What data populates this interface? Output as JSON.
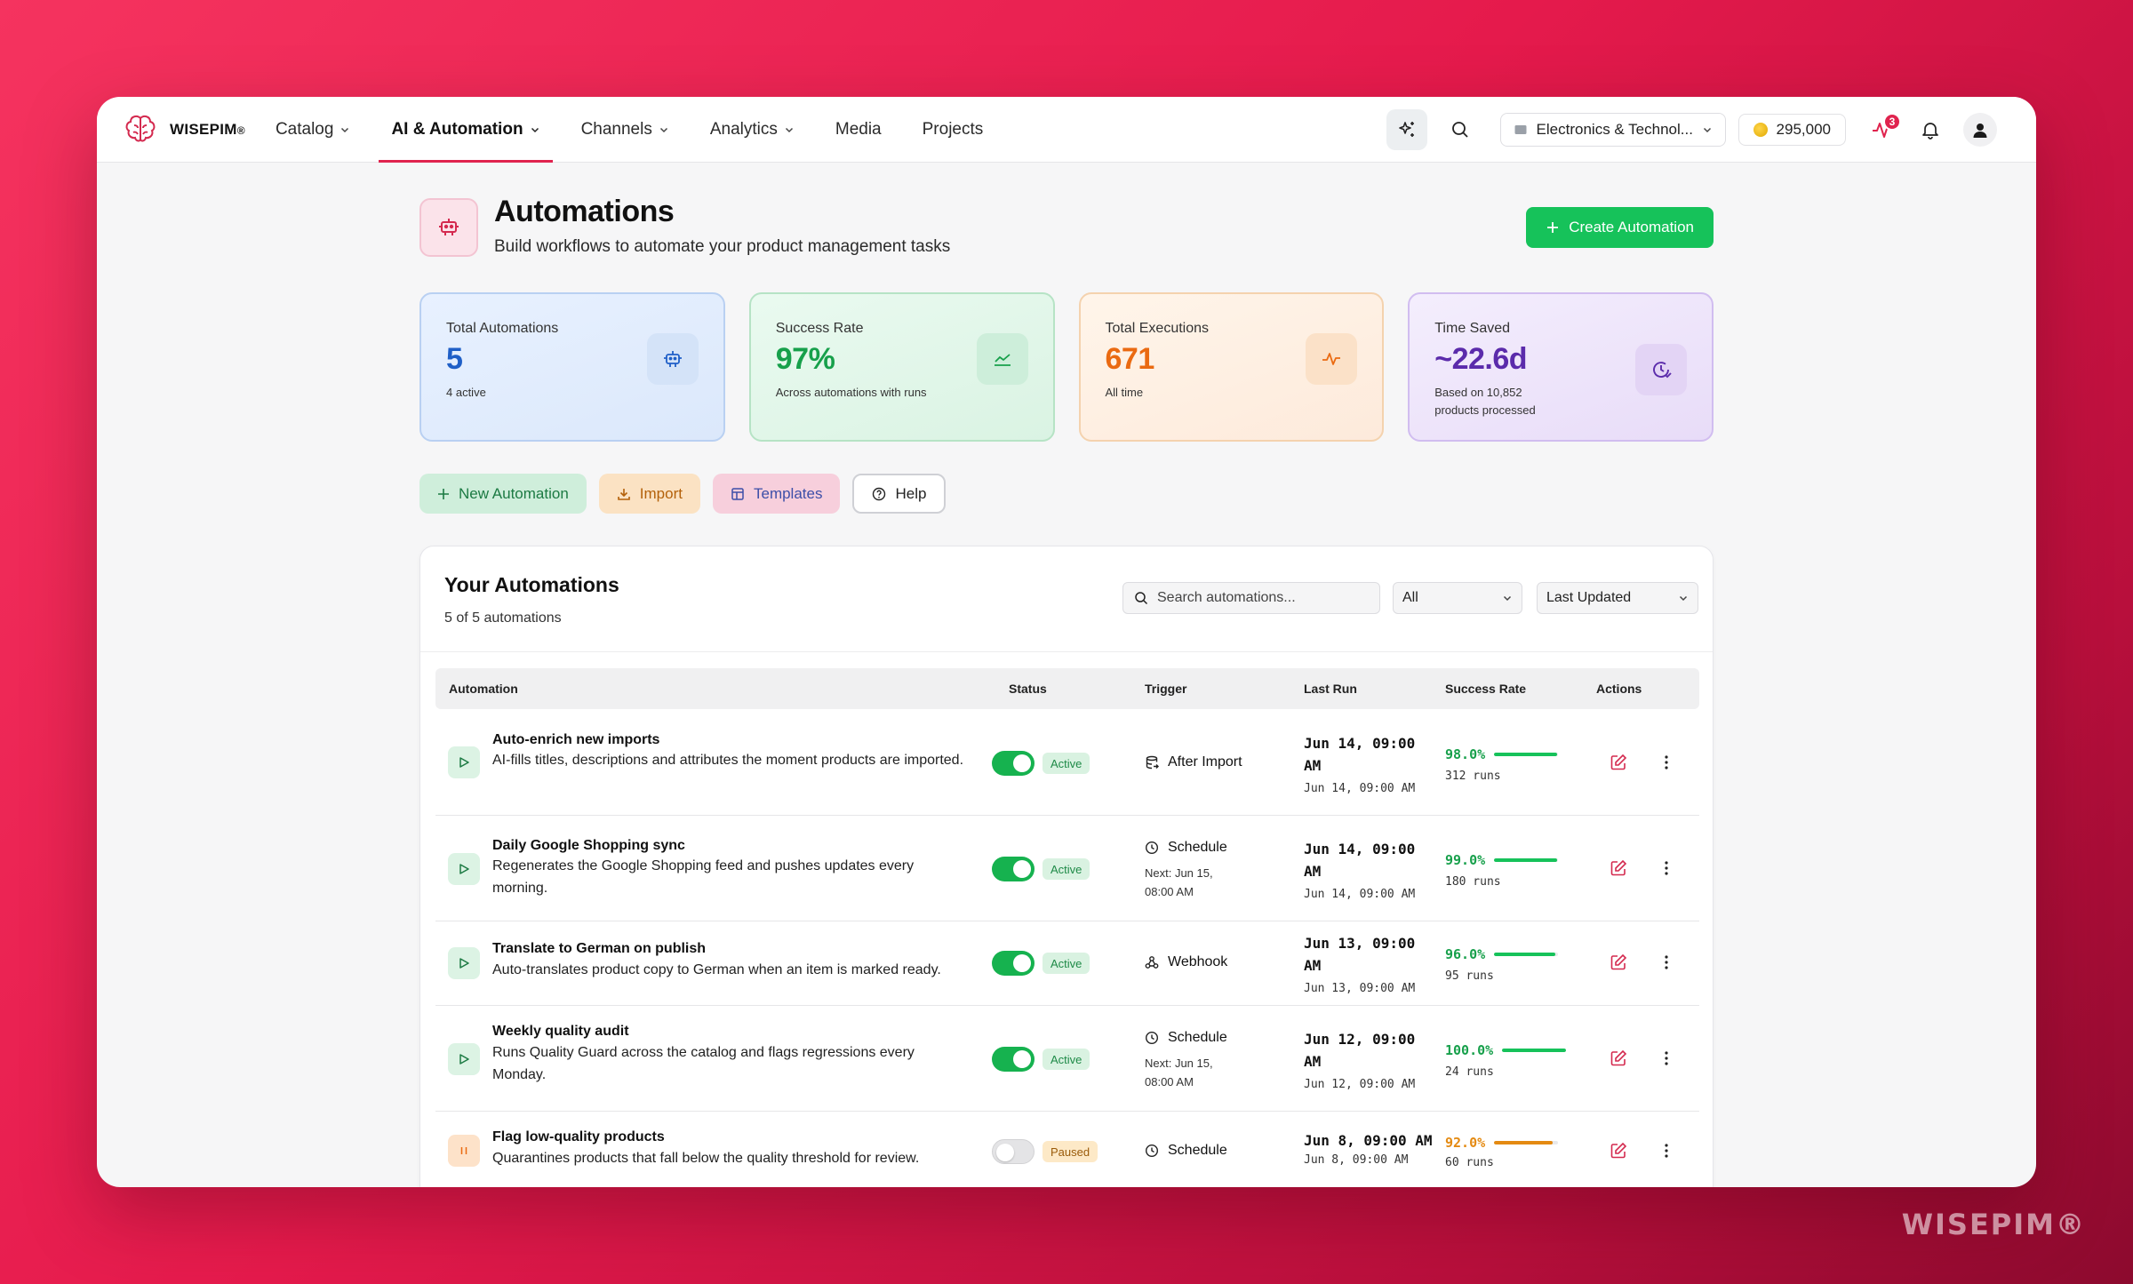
{
  "brand": {
    "name": "WISEPIM",
    "mark": "®"
  },
  "nav": {
    "items": [
      {
        "label": "Catalog",
        "dropdown": true,
        "active": false
      },
      {
        "label": "AI & Automation",
        "dropdown": true,
        "active": true
      },
      {
        "label": "Channels",
        "dropdown": true,
        "active": false
      },
      {
        "label": "Analytics",
        "dropdown": true,
        "active": false
      },
      {
        "label": "Media",
        "dropdown": false,
        "active": false
      },
      {
        "label": "Projects",
        "dropdown": false,
        "active": false
      }
    ],
    "catalog_select": "Electronics & Technol...",
    "credits": "295,000",
    "activity_badge": "3"
  },
  "page": {
    "title": "Automations",
    "subtitle": "Build workflows to automate your product management tasks",
    "create_button": "Create Automation"
  },
  "stats": [
    {
      "label": "Total Automations",
      "value": "5",
      "sub": "4 active",
      "color": "#1f5fc7",
      "icon": "robot-icon"
    },
    {
      "label": "Success Rate",
      "value": "97%",
      "sub": "Across automations with runs",
      "color": "#17a04b",
      "icon": "trend-chart-icon"
    },
    {
      "label": "Total Executions",
      "value": "671",
      "sub": "All time",
      "color": "#ea6a11",
      "icon": "activity-pulse-icon"
    },
    {
      "label": "Time Saved",
      "value": "~22.6d",
      "sub_line1": "Based on 10,852",
      "sub_line2": "products processed",
      "color": "#5b2bab",
      "icon": "clock-history-icon"
    }
  ],
  "quick_actions": {
    "new": "New Automation",
    "import": "Import",
    "templates": "Templates",
    "help": "Help"
  },
  "list": {
    "title": "Your Automations",
    "count": "5 of 5 automations",
    "search_placeholder": "Search automations...",
    "filter": "All",
    "sort": "Last Updated",
    "columns": {
      "automation": "Automation",
      "status": "Status",
      "trigger": "Trigger",
      "last_run": "Last Run",
      "success_rate": "Success Rate",
      "actions": "Actions"
    },
    "rows": [
      {
        "name": "Auto-enrich new imports",
        "desc": "AI-fills titles, descriptions and attributes the moment products are imported.",
        "enabled": true,
        "status": "Active",
        "trigger": "After Import",
        "trigger_icon": "database-import-icon",
        "next": "",
        "last_run": "Jun 14, 09:00 AM",
        "last_run_sub": "Jun 14, 09:00 AM",
        "rate": "98.0%",
        "rate_value": 0.98,
        "runs": "312 runs"
      },
      {
        "name": "Daily Google Shopping sync",
        "desc": "Regenerates the Google Shopping feed and pushes updates every morning.",
        "enabled": true,
        "status": "Active",
        "trigger": "Schedule",
        "trigger_icon": "clock-icon",
        "next": "Next: Jun 15, 08:00 AM",
        "last_run": "Jun 14, 09:00 AM",
        "last_run_sub": "Jun 14, 09:00 AM",
        "rate": "99.0%",
        "rate_value": 0.99,
        "runs": "180 runs"
      },
      {
        "name": "Translate to German on publish",
        "desc": "Auto-translates product copy to German when an item is marked ready.",
        "enabled": true,
        "status": "Active",
        "trigger": "Webhook",
        "trigger_icon": "webhook-icon",
        "next": "",
        "last_run": "Jun 13, 09:00 AM",
        "last_run_sub": "Jun 13, 09:00 AM",
        "rate": "96.0%",
        "rate_value": 0.96,
        "runs": "95 runs"
      },
      {
        "name": "Weekly quality audit",
        "desc": "Runs Quality Guard across the catalog and flags regressions every Monday.",
        "enabled": true,
        "status": "Active",
        "trigger": "Schedule",
        "trigger_icon": "clock-icon",
        "next": "Next: Jun 15, 08:00 AM",
        "last_run": "Jun 12, 09:00 AM",
        "last_run_sub": "Jun 12, 09:00 AM",
        "rate": "100.0%",
        "rate_value": 1.0,
        "runs": "24 runs"
      },
      {
        "name": "Flag low-quality products",
        "desc": "Quarantines products that fall below the quality threshold for review.",
        "enabled": false,
        "status": "Paused",
        "trigger": "Schedule",
        "trigger_icon": "clock-icon",
        "next": "",
        "last_run": "Jun 8, 09:00 AM",
        "last_run_sub": "Jun 8, 09:00 AM",
        "rate": "92.0%",
        "rate_value": 0.92,
        "runs": "60 runs"
      }
    ]
  },
  "watermark": "WISEPIM®",
  "colors": {
    "accent": "#e0234e",
    "success": "#16c25a",
    "warning": "#e48a12"
  }
}
